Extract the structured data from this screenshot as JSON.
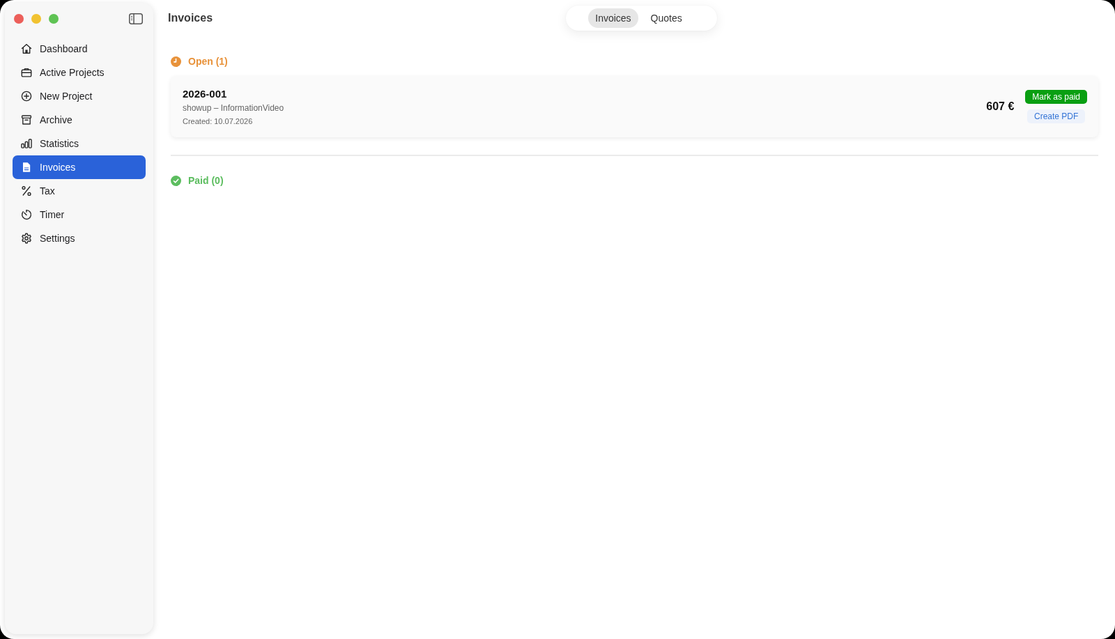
{
  "sidebar": {
    "items": [
      {
        "label": "Dashboard",
        "selected": false
      },
      {
        "label": "Active Projects",
        "selected": false
      },
      {
        "label": "New Project",
        "selected": false
      },
      {
        "label": "Archive",
        "selected": false
      },
      {
        "label": "Statistics",
        "selected": false
      },
      {
        "label": "Invoices",
        "selected": true
      },
      {
        "label": "Tax",
        "selected": false
      },
      {
        "label": "Timer",
        "selected": false
      },
      {
        "label": "Settings",
        "selected": false
      }
    ]
  },
  "header": {
    "title": "Invoices"
  },
  "segments": [
    {
      "label": "Invoices",
      "selected": true
    },
    {
      "label": "Quotes",
      "selected": false
    }
  ],
  "sections": [
    {
      "kind": "open",
      "title": "Open (1)",
      "color": "#e8923a",
      "invoices": [
        {
          "number": "2026-001",
          "client": "showup – InformationVideo",
          "created": "Created: 10.07.2026",
          "amount": "607 €",
          "actions": [
            {
              "label": "Mark as paid",
              "kind": "primary"
            },
            {
              "label": "Create PDF",
              "kind": "secondary"
            }
          ]
        }
      ]
    },
    {
      "kind": "paid",
      "title": "Paid (0)",
      "color": "#5cbd5f"
    }
  ]
}
